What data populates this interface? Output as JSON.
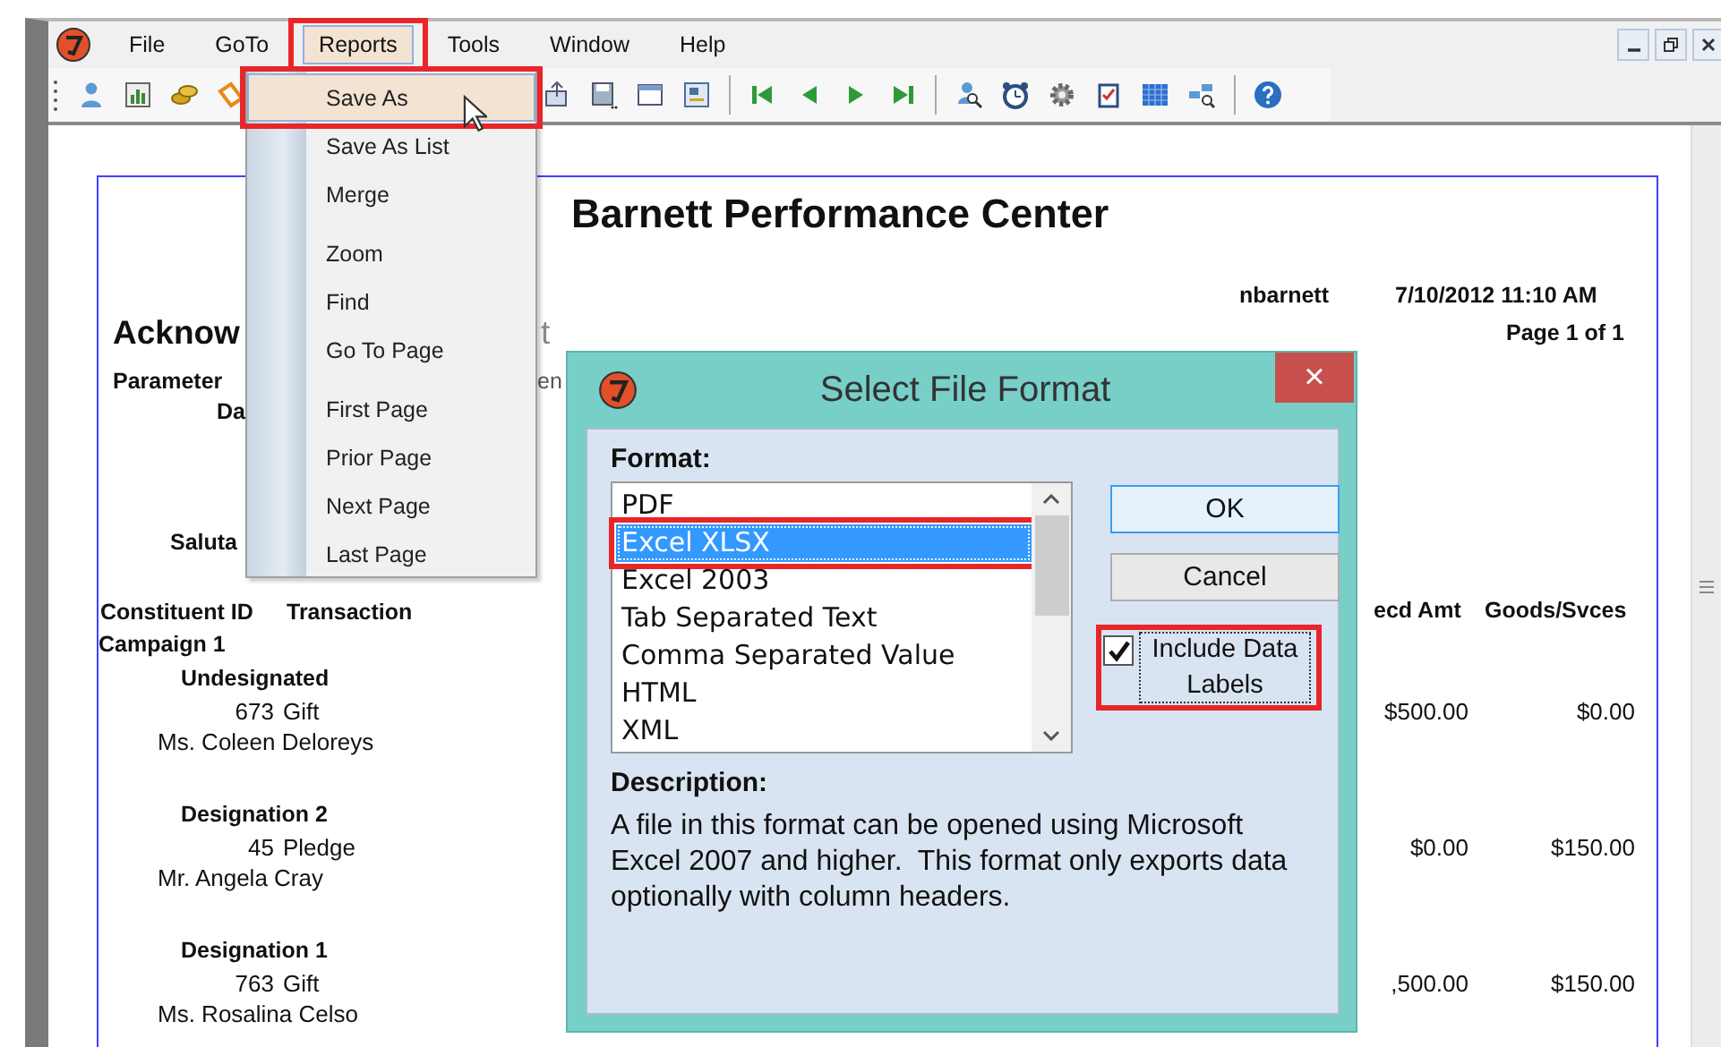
{
  "menu_bar": [
    {
      "label": "File",
      "selected": false,
      "callout": false
    },
    {
      "label": "GoTo",
      "selected": false,
      "callout": false
    },
    {
      "label": "Reports",
      "selected": true,
      "callout": true
    },
    {
      "label": "Tools",
      "selected": false,
      "callout": false
    },
    {
      "label": "Window",
      "selected": false,
      "callout": false
    },
    {
      "label": "Help",
      "selected": false,
      "callout": false
    }
  ],
  "reports_menu": [
    {
      "kind": "item",
      "label": "Save As",
      "selected": true,
      "callout": true
    },
    {
      "kind": "item",
      "label": "Save As List",
      "selected": false,
      "callout": false
    },
    {
      "kind": "item",
      "label": "Merge",
      "selected": false,
      "callout": false
    },
    {
      "kind": "separator"
    },
    {
      "kind": "item",
      "label": "Zoom",
      "selected": false,
      "callout": false
    },
    {
      "kind": "item",
      "label": "Find",
      "selected": false,
      "callout": false
    },
    {
      "kind": "item",
      "label": "Go To Page",
      "selected": false,
      "callout": false
    },
    {
      "kind": "separator"
    },
    {
      "kind": "item",
      "label": "First Page",
      "selected": false,
      "callout": false
    },
    {
      "kind": "item",
      "label": "Prior Page",
      "selected": false,
      "callout": false
    },
    {
      "kind": "item",
      "label": "Next Page",
      "selected": false,
      "callout": false
    },
    {
      "kind": "item",
      "label": "Last Page",
      "selected": false,
      "callout": false
    }
  ],
  "report": {
    "title": "Barnett Performance Center",
    "user": "nbarnett",
    "timestamp": "7/10/2012 11:10 AM",
    "page": "Page 1 of 1",
    "heading": "Acknow",
    "heading_tail": "t",
    "parameters_label": "Parameter",
    "parameters_tail": "en",
    "date_label": "Da",
    "salutation_label": "Saluta",
    "columns": [
      "Constituent ID",
      "Transaction"
    ],
    "amount_columns": [
      "ecd Amt",
      "Goods/Svces"
    ],
    "campaign": "Campaign 1",
    "groups": [
      {
        "designation": "Undesignated",
        "constituent_id": "673",
        "transaction": "Gift",
        "name": "Ms. Coleen Deloreys",
        "amount": "$500.00",
        "goods": "$0.00"
      },
      {
        "designation": "Designation 2",
        "constituent_id": "45",
        "transaction": "Pledge",
        "name": "Mr. Angela Cray",
        "amount": "$0.00",
        "goods": "$150.00"
      },
      {
        "designation": "Designation 1",
        "constituent_id": "763",
        "transaction": "Gift",
        "name": "Ms. Rosalina Celso",
        "amount": ",500.00",
        "goods": "$150.00"
      }
    ]
  },
  "dialog": {
    "title": "Select File Format",
    "close": "×",
    "format_label": "Format:",
    "formats": [
      {
        "label": "PDF",
        "selected": false,
        "callout": false
      },
      {
        "label": "Excel XLSX",
        "selected": true,
        "callout": true
      },
      {
        "label": "Excel 2003",
        "selected": false,
        "callout": false
      },
      {
        "label": "Tab Separated Text",
        "selected": false,
        "callout": false
      },
      {
        "label": "Comma Separated Value",
        "selected": false,
        "callout": false
      },
      {
        "label": "HTML",
        "selected": false,
        "callout": false
      },
      {
        "label": "XML",
        "selected": false,
        "callout": false
      }
    ],
    "buttons": [
      "OK",
      "Cancel"
    ],
    "include_labels": {
      "label": "Include Data Labels",
      "checked": true,
      "callout": true
    },
    "description_label": "Description:",
    "description": "A file in this format can be opened using Microsoft Excel 2007 and higher.  This format only exports data optionally with column headers."
  }
}
